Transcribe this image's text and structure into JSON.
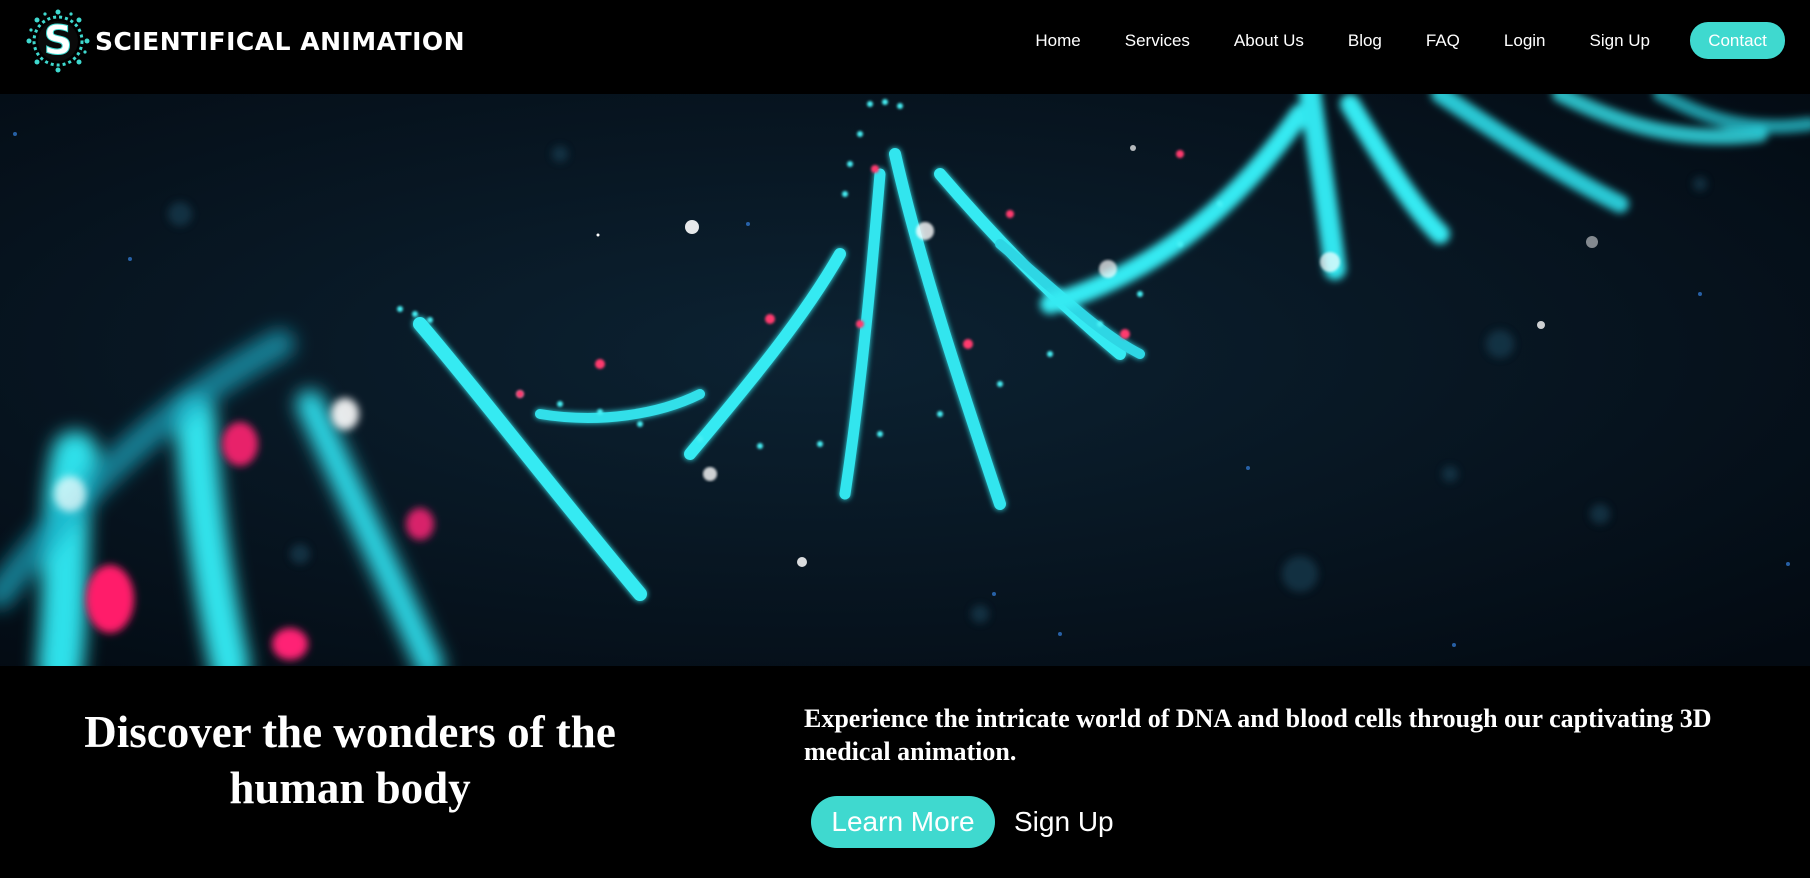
{
  "brand": {
    "name": "SCIENTIFICAL ANIMATION",
    "logo_letter": "S",
    "accent_color": "#3fd9cf",
    "logo_icon": "virus-s-logo-icon"
  },
  "nav": {
    "items": [
      {
        "label": "Home"
      },
      {
        "label": "Services"
      },
      {
        "label": "About Us"
      },
      {
        "label": "Blog"
      },
      {
        "label": "FAQ"
      },
      {
        "label": "Login"
      },
      {
        "label": "Sign Up"
      }
    ],
    "contact_label": "Contact"
  },
  "hero": {
    "image": "dna-double-helix-image",
    "colors": {
      "helix": "#33e3ec",
      "highlight": "#ff2f7a",
      "background": "#071622"
    }
  },
  "content": {
    "headline": "Discover the wonders of the human body",
    "subtext": "Experience the intricate world of DNA and blood cells through our captivating 3D medical animation.",
    "learn_more_label": "Learn More",
    "sign_up_label": "Sign Up"
  }
}
